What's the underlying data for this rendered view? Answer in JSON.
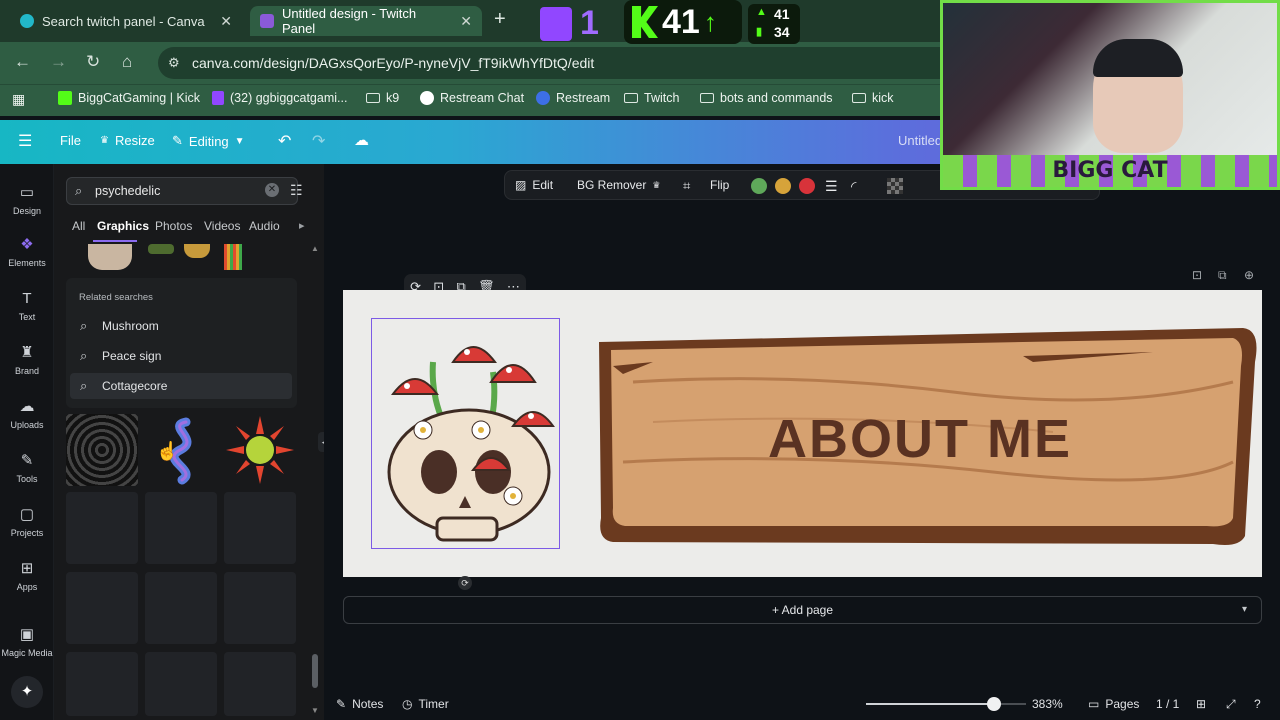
{
  "browser": {
    "tabs": [
      {
        "label": "Search twitch panel - Canva",
        "active": false
      },
      {
        "label": "Untitled design - Twitch Panel",
        "active": true
      }
    ],
    "url": "canva.com/design/DAGxsQorEyo/P-nyneVjV_fT9ikWhYfDtQ/edit",
    "bookmarks": [
      "BiggCatGaming | Kick",
      "(32) ggbiggcatgami...",
      "k9",
      "Restream Chat",
      "Restream",
      "Twitch",
      "bots and commands",
      "kick"
    ]
  },
  "overlay": {
    "twitch_count": "1",
    "kick_count": "41",
    "stat_top": "41",
    "stat_bottom": "34",
    "cam_label": "BIGG CAT"
  },
  "canva_header": {
    "file": "File",
    "resize": "Resize",
    "editing": "Editing",
    "doc_title": "Untitled"
  },
  "rail": [
    {
      "label": "Design",
      "icon": "design-icon"
    },
    {
      "label": "Elements",
      "icon": "elements-icon"
    },
    {
      "label": "Text",
      "icon": "text-icon"
    },
    {
      "label": "Brand",
      "icon": "brand-icon"
    },
    {
      "label": "Uploads",
      "icon": "uploads-icon"
    },
    {
      "label": "Tools",
      "icon": "tools-icon"
    },
    {
      "label": "Projects",
      "icon": "projects-icon"
    },
    {
      "label": "Apps",
      "icon": "apps-icon"
    },
    {
      "label": "Magic Media",
      "icon": "magic-media-icon"
    }
  ],
  "panel": {
    "search_value": "psychedelic",
    "filter_tabs": [
      "All",
      "Graphics",
      "Photos",
      "Videos",
      "Audio"
    ],
    "related_title": "Related searches",
    "related": [
      "Mushroom",
      "Peace sign",
      "Cottagecore"
    ]
  },
  "context_toolbar": {
    "edit": "Edit",
    "bg_remover": "BG Remover",
    "flip": "Flip",
    "colors": [
      "#5fa85a",
      "#d6a33a",
      "#d8333a"
    ]
  },
  "design": {
    "heading": "ABOUT ME"
  },
  "canvas": {
    "add_page": "+ Add page"
  },
  "footer": {
    "notes": "Notes",
    "timer": "Timer",
    "zoom": "383%",
    "zoom_level": 0.8,
    "pages": "Pages",
    "page_count": "1 / 1"
  }
}
